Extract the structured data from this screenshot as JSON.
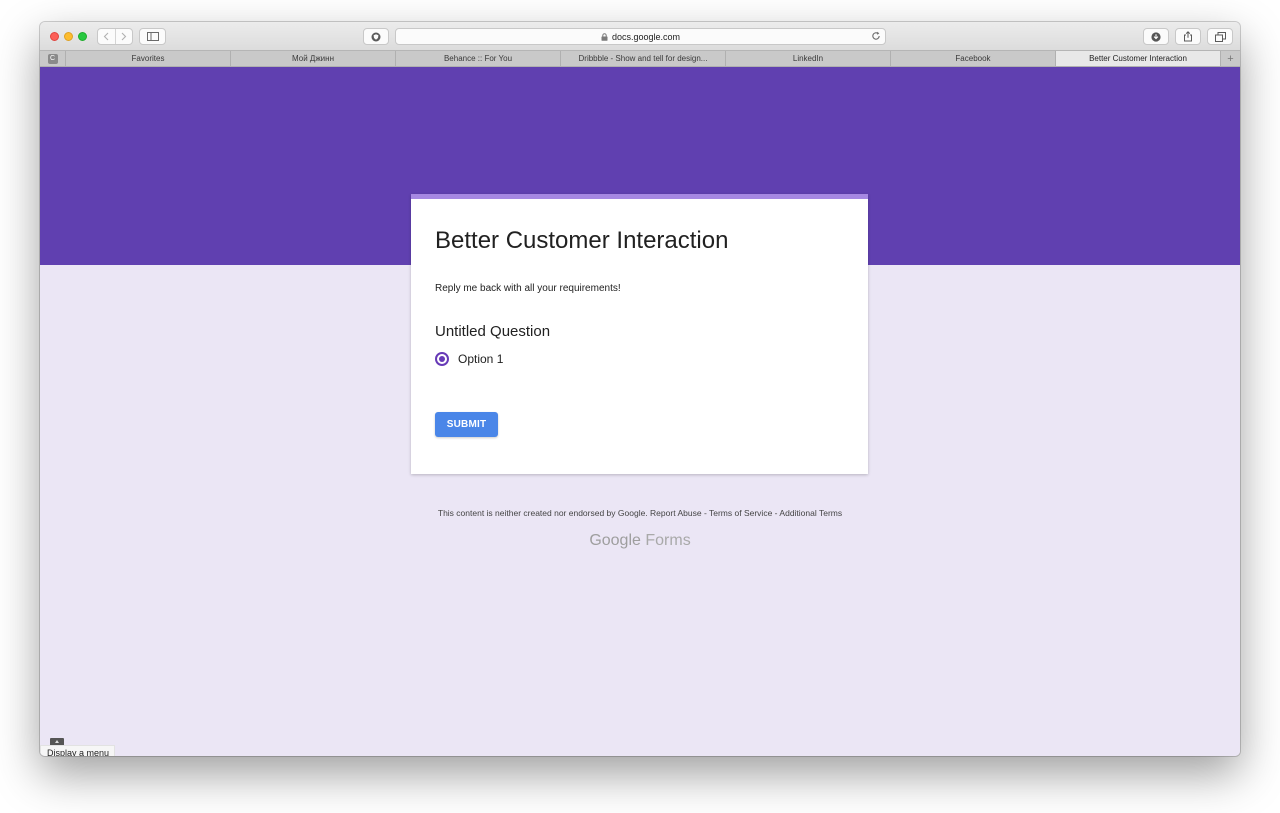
{
  "browser": {
    "address": "docs.google.com",
    "tabs": [
      {
        "label": "Favorites"
      },
      {
        "label": "Мой Джинн"
      },
      {
        "label": "Behance :: For You"
      },
      {
        "label": "Dribbble - Show and tell for design..."
      },
      {
        "label": "LinkedIn"
      },
      {
        "label": "Facebook"
      },
      {
        "label": "Better Customer Interaction"
      }
    ],
    "favicon_letter": "C",
    "add_tab": "+"
  },
  "form": {
    "title": "Better Customer Interaction",
    "description": "Reply me back with all your requirements!",
    "question": "Untitled Question",
    "option": "Option 1",
    "option_selected": true,
    "submit_label": "SUBMIT"
  },
  "footer": {
    "note": "This content is neither created nor endorsed by Google.",
    "report_abuse": "Report Abuse",
    "sep1": "-",
    "terms": "Terms of Service",
    "sep2": "-",
    "additional": "Additional Terms",
    "brand_google": "Google",
    "brand_forms": "Forms"
  },
  "tooltip": {
    "label": "Display a menu"
  },
  "colors": {
    "banner": "#6040b0",
    "card_accent": "#a688e2",
    "page_bg": "#ebe6f5",
    "radio": "#673ab7",
    "submit_bg": "#4a86e8"
  }
}
